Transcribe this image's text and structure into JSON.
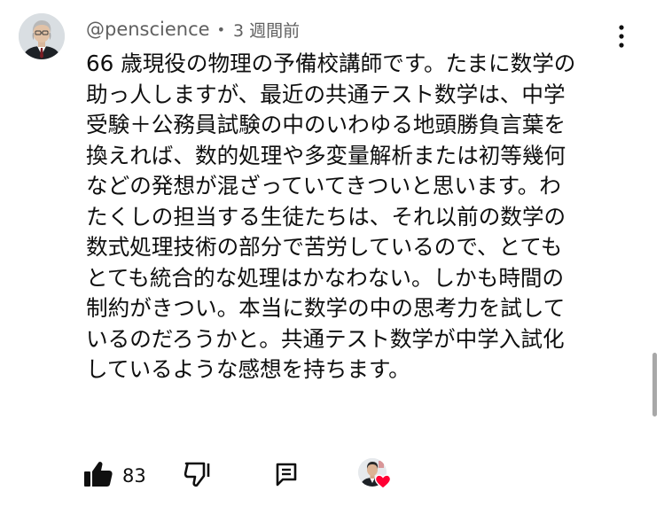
{
  "comment": {
    "author": "@penscience",
    "separator": "•",
    "time": "3 週間前",
    "lines": [
      "66 歳現役の物理の予備校講師です。たまに数学の",
      "助っ人しますが、最近の共通テスト数学は、中学",
      "受験＋公務員試験の中のいわゆる地頭勝負言葉を",
      "換えれば、数的処理や多変量解析または初等幾何",
      "などの発想が混ざっていてきついと思います。わ",
      "たくしの担当する生徒たちは、それ以前の数学の",
      "数式処理技術の部分で苦労しているので、とても",
      "とても統合的な処理はかなわない。しかも時間の",
      "制約がきつい。本当に数学の中の思考力を試して",
      "いるのだろうかと。共通テスト数学が中学入試化",
      "しているような感想を持ちます。"
    ]
  },
  "actions": {
    "like_count": "83",
    "like_icon": "thumbs-up-filled",
    "dislike_icon": "thumbs-down-outline",
    "reply_icon": "comment-reply",
    "hearted_icon": "creator-heart"
  },
  "colors": {
    "text": "#0f0f0f",
    "meta": "#606060",
    "heart": "#ff0033"
  }
}
